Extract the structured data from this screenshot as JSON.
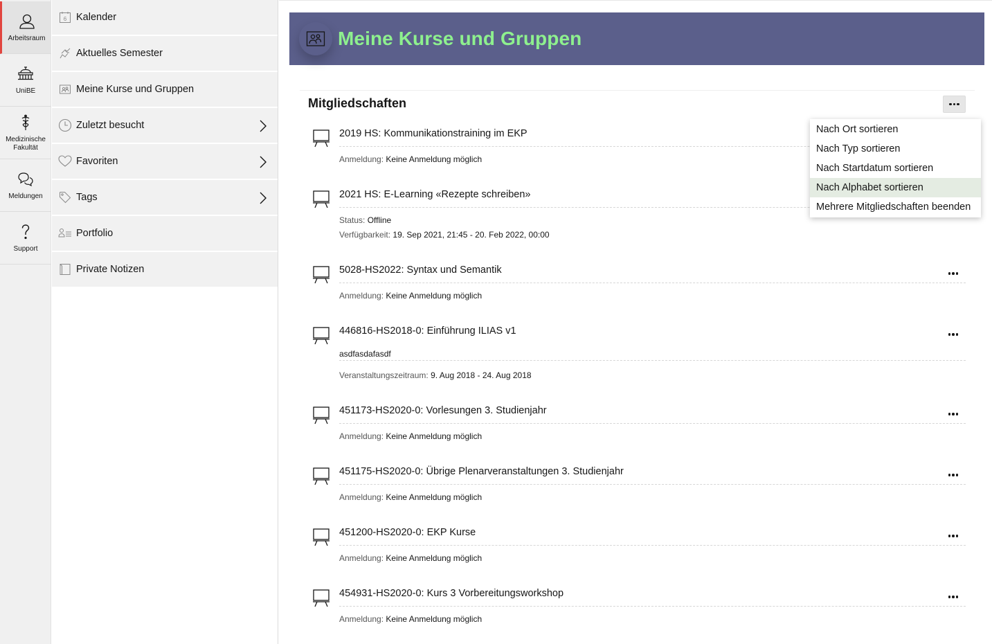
{
  "mainbar": {
    "items": [
      {
        "label": "Arbeitsraum",
        "icon": "user-icon"
      },
      {
        "label": "UniBE",
        "icon": "institution-icon"
      },
      {
        "label": "Medizinische Fakultät",
        "icon": "caduceus-icon"
      },
      {
        "label": "Meldungen",
        "icon": "chat-bubbles-icon"
      },
      {
        "label": "Support",
        "icon": "question-icon"
      }
    ]
  },
  "slate": {
    "items": [
      {
        "label": "Kalender",
        "icon": "calendar-icon",
        "num": "6"
      },
      {
        "label": "Aktuelles Semester",
        "icon": "semester-icon"
      },
      {
        "label": "Meine Kurse und Gruppen",
        "icon": "courses-groups-icon"
      },
      {
        "label": "Zuletzt besucht",
        "icon": "clock-icon"
      },
      {
        "label": "Favoriten",
        "icon": "heart-icon"
      },
      {
        "label": "Tags",
        "icon": "tag-icon"
      },
      {
        "label": "Portfolio",
        "icon": "portfolio-icon"
      },
      {
        "label": "Private Notizen",
        "icon": "notes-icon"
      }
    ]
  },
  "header": {
    "title": "Meine Kurse und Gruppen"
  },
  "panel": {
    "title": "Mitgliedschaften",
    "courses": [
      {
        "title": "2019 HS: Kommunikationstraining im EKP",
        "k1": "Anmeldung:",
        "v1": "Keine Anmeldung möglich"
      },
      {
        "title": "2021 HS: E-Learning «Rezepte schreiben»",
        "k1": "Status:",
        "v1": "Offline",
        "k2": "Verfügbarkeit:",
        "v2": "19. Sep 2021, 21:45 - 20. Feb 2022, 00:00"
      },
      {
        "title": "5028-HS2022: Syntax und Semantik",
        "k1": "Anmeldung:",
        "v1": "Keine Anmeldung möglich"
      },
      {
        "title": "446816-HS2018-0: Einführung ILIAS v1",
        "desc": "asdfasdafasdf",
        "k1": "Veranstaltungszeitraum:",
        "v1": "9. Aug 2018 - 24. Aug 2018"
      },
      {
        "title": "451173-HS2020-0: Vorlesungen 3. Studienjahr",
        "k1": "Anmeldung:",
        "v1": "Keine Anmeldung möglich"
      },
      {
        "title": "451175-HS2020-0: Übrige Plenarveranstaltungen 3. Studienjahr",
        "k1": "Anmeldung:",
        "v1": "Keine Anmeldung möglich"
      },
      {
        "title": "451200-HS2020-0: EKP Kurse",
        "k1": "Anmeldung:",
        "v1": "Keine Anmeldung möglich"
      },
      {
        "title": "454931-HS2020-0: Kurs 3 Vorbereitungsworkshop",
        "k1": "Anmeldung:",
        "v1": "Keine Anmeldung möglich"
      }
    ]
  },
  "dropdown": {
    "items": [
      "Nach Ort sortieren",
      "Nach Typ sortieren",
      "Nach Startdatum sortieren",
      "Nach Alphabet sortieren",
      "Mehrere Mitgliedschaften beenden"
    ],
    "highlighted": "Nach Alphabet sortieren"
  },
  "colors": {
    "header_bg": "#5b5f8b",
    "header_title": "#8ef08e",
    "active_marker": "#e1453f",
    "menu_hover": "#e4ece2"
  }
}
